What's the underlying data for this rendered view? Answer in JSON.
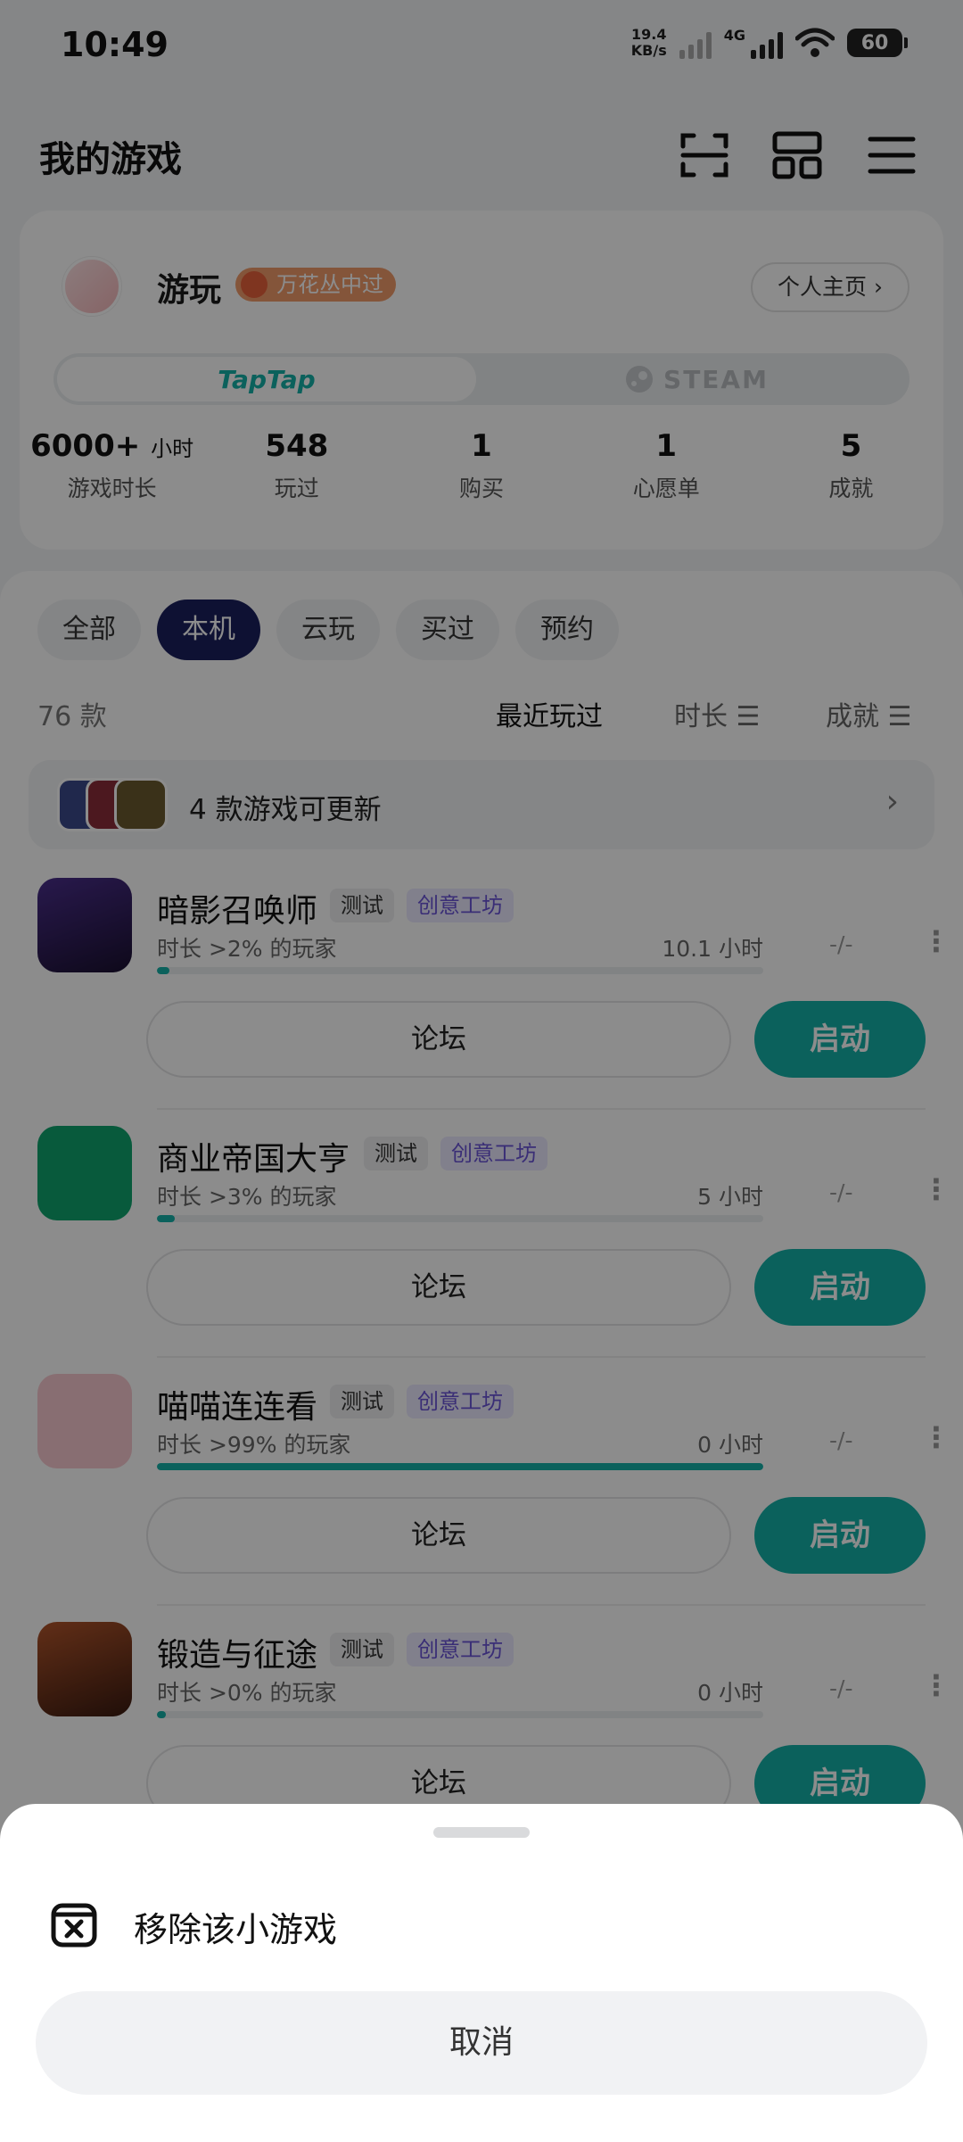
{
  "status_bar": {
    "time": "10:49",
    "net_speed_value": "19.4",
    "net_speed_unit": "KB/s",
    "signal_label": "4G",
    "battery": "60"
  },
  "header": {
    "title": "我的游戏",
    "icons": [
      "scan-icon",
      "apps-grid-icon",
      "menu-icon"
    ]
  },
  "profile": {
    "username": "游玩",
    "rank_badge": "万花丛中过",
    "homepage_label": "个人主页 ›",
    "platform_tabs": [
      {
        "label": "TapTap",
        "active": true
      },
      {
        "label": "STEAM",
        "active": false
      }
    ],
    "stats": [
      {
        "value": "6000+",
        "unit": "小时",
        "label": "游戏时长"
      },
      {
        "value": "548",
        "unit": "",
        "label": "玩过"
      },
      {
        "value": "1",
        "unit": "",
        "label": "购买"
      },
      {
        "value": "1",
        "unit": "",
        "label": "心愿单"
      },
      {
        "value": "5",
        "unit": "",
        "label": "成就"
      }
    ]
  },
  "library": {
    "filters": [
      {
        "label": "全部",
        "active": false
      },
      {
        "label": "本机",
        "active": true
      },
      {
        "label": "云玩",
        "active": false
      },
      {
        "label": "买过",
        "active": false
      },
      {
        "label": "预约",
        "active": false
      }
    ],
    "count": "76 款",
    "sort_options": [
      {
        "label": "最近玩过",
        "active": true
      },
      {
        "label": "时长 ☰",
        "active": false
      },
      {
        "label": "成就 ☰",
        "active": false
      }
    ],
    "update_banner": {
      "text": "4 款游戏可更新",
      "icon_colors": [
        "#3b4a8a",
        "#8a2d3a",
        "#6b5a2e"
      ]
    },
    "games": [
      {
        "name": "暗影召唤师",
        "tag_test": "测试",
        "tag_workshop": "创意工坊",
        "percentile": "时长 >2% 的玩家",
        "hours": "10.1 小时",
        "achievements": "-/-",
        "progress": 0.02,
        "forum": "论坛",
        "launch": "启动",
        "icon_color": "#2a1f4e"
      },
      {
        "name": "商业帝国大亨",
        "tag_test": "测试",
        "tag_workshop": "创意工坊",
        "percentile": "时长 >3% 的玩家",
        "hours": "5 小时",
        "achievements": "-/-",
        "progress": 0.03,
        "forum": "论坛",
        "launch": "启动",
        "icon_color": "#10a56e"
      },
      {
        "name": "喵喵连连看",
        "tag_test": "测试",
        "tag_workshop": "创意工坊",
        "percentile": "时长 >99% 的玩家",
        "hours": "0 小时",
        "achievements": "-/-",
        "progress": 1.0,
        "forum": "论坛",
        "launch": "启动",
        "icon_color": "#f7c9cf"
      },
      {
        "name": "锻造与征途",
        "tag_test": "测试",
        "tag_workshop": "创意工坊",
        "percentile": "时长 >0% 的玩家",
        "hours": "0 小时",
        "achievements": "-/-",
        "progress": 0.0,
        "forum": "论坛",
        "launch": "启动",
        "icon_color": "#8a3a1f"
      }
    ]
  },
  "sheet": {
    "remove_label": "移除该小游戏",
    "cancel_label": "取消"
  },
  "colors": {
    "accent": "#15b1a8",
    "active_chip": "#1b1f5e",
    "workshop_text": "#6a55d8"
  }
}
